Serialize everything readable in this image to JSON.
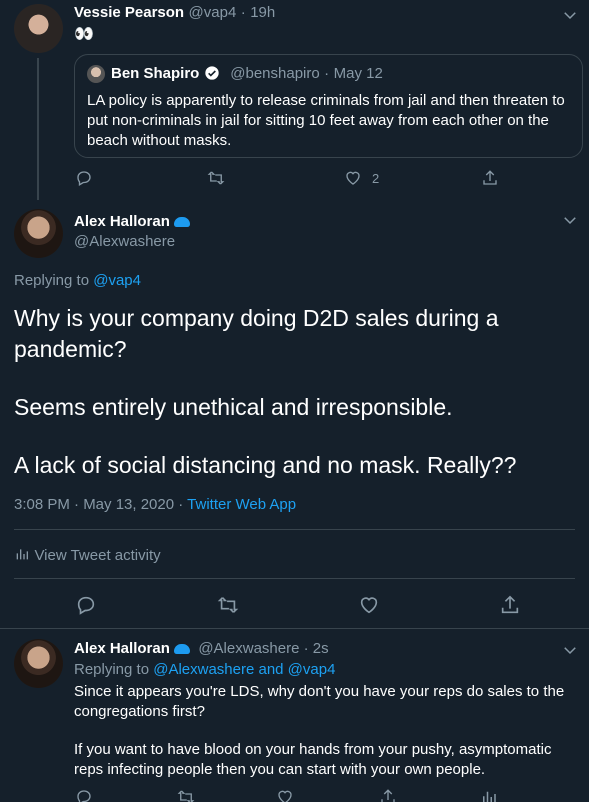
{
  "tweet1": {
    "name": "Vessie Pearson",
    "handle": "@vap4",
    "time": "19h",
    "emoji": "👀",
    "quote": {
      "name": "Ben Shapiro",
      "handle": "@benshapiro",
      "date": "May 12",
      "text": "LA policy is apparently to release criminals from jail and then threaten to put non-criminals in jail for sitting 10 feet away from each other on the beach without masks."
    },
    "like_count": "2"
  },
  "tweet2": {
    "name": "Alex Halloran",
    "handle": "@Alexwashere",
    "replying_prefix": "Replying to",
    "replying_to": "@vap4",
    "lines": [
      "Why is your company doing D2D sales during a",
      "pandemic?",
      "Seems entirely unethical and irresponsible.",
      "A lack of social distancing and no mask. Really??"
    ],
    "timestamp": "3:08 PM · May 13, 2020 · ",
    "source": "Twitter Web App",
    "activity": "View Tweet activity"
  },
  "tweet3": {
    "name": "Alex Halloran",
    "handle_time": "@Alexwashere · 2s",
    "replying_prefix": "Replying to",
    "replying_to": "@Alexwashere and @vap4",
    "para1_l1": "Since it appears you're LDS, why don't you have your reps do sales to the",
    "para1_l2": "congregations first?",
    "para2_l1": "If you want to have blood on your hands from your pushy, asymptomatic",
    "para2_l2": "reps infecting people then you can start with your own people."
  },
  "icons": {
    "reply": "reply-icon",
    "retweet": "retweet-icon",
    "like": "heart-icon",
    "share": "share-icon",
    "stats": "stats-icon",
    "verified": "verified-badge-icon",
    "more": "chevron-down-icon"
  },
  "colors": {
    "background": "#15202b",
    "accent": "#1da1f2",
    "muted": "#8899a6",
    "border": "#38444d"
  }
}
